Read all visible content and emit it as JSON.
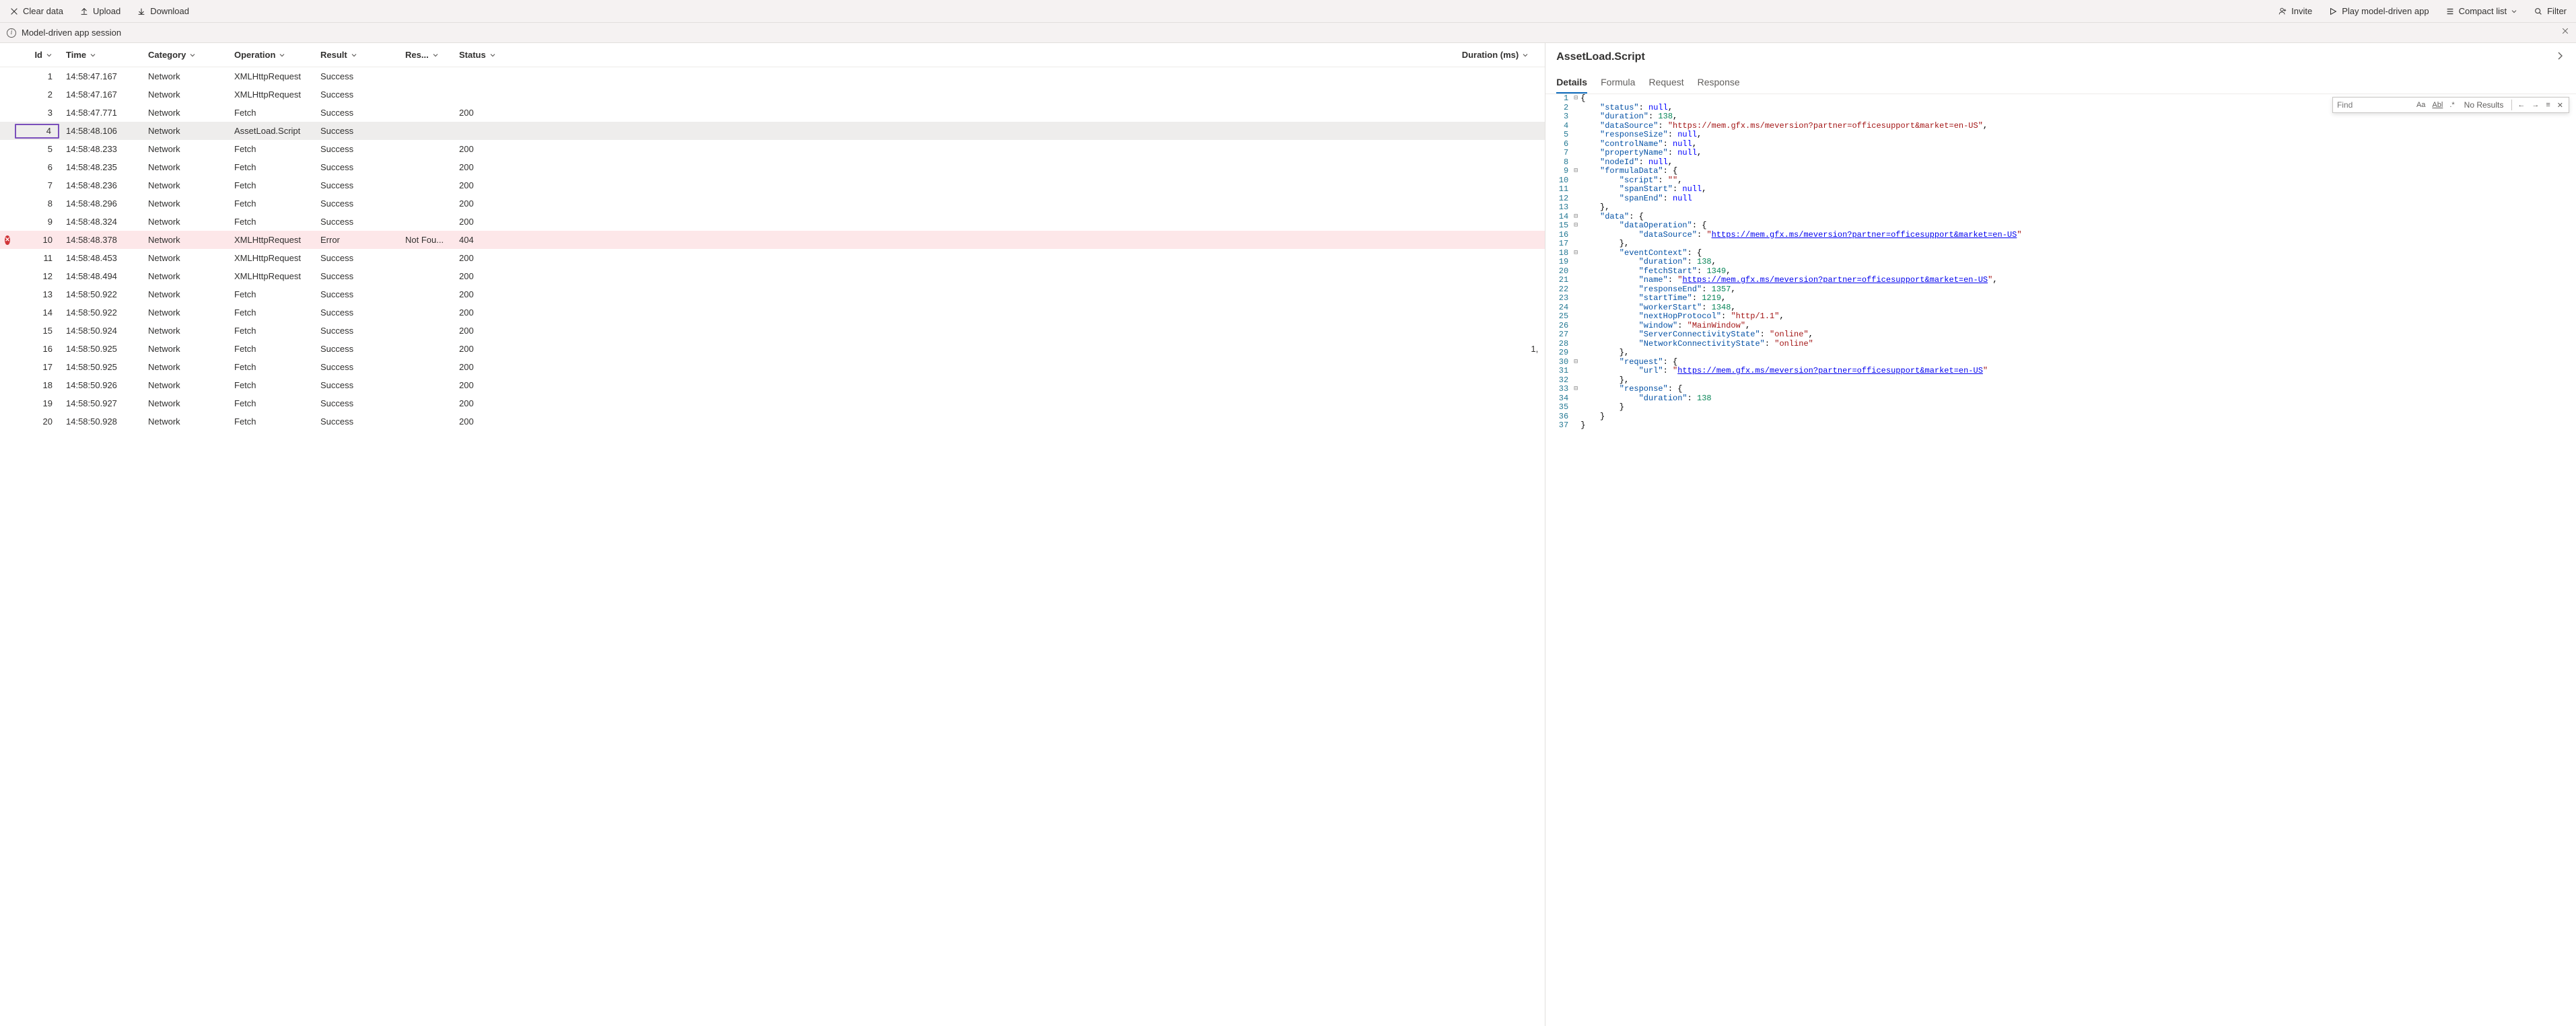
{
  "toolbar": {
    "clear": "Clear data",
    "upload": "Upload",
    "download": "Download",
    "invite": "Invite",
    "play": "Play model-driven app",
    "compact": "Compact list",
    "filter": "Filter"
  },
  "session": {
    "title": "Model-driven app session"
  },
  "table": {
    "columns": {
      "id": "Id",
      "time": "Time",
      "category": "Category",
      "operation": "Operation",
      "result": "Result",
      "result2": "Res...",
      "status": "Status",
      "duration": "Duration (ms)"
    },
    "rows": [
      {
        "id": 1,
        "time": "14:58:47.167",
        "category": "Network",
        "operation": "XMLHttpRequest",
        "result": "Success",
        "result2": "",
        "status": "",
        "duration": "",
        "flag": ""
      },
      {
        "id": 2,
        "time": "14:58:47.167",
        "category": "Network",
        "operation": "XMLHttpRequest",
        "result": "Success",
        "result2": "",
        "status": "",
        "duration": "",
        "flag": ""
      },
      {
        "id": 3,
        "time": "14:58:47.771",
        "category": "Network",
        "operation": "Fetch",
        "result": "Success",
        "result2": "",
        "status": "200",
        "duration": "",
        "flag": ""
      },
      {
        "id": 4,
        "time": "14:58:48.106",
        "category": "Network",
        "operation": "AssetLoad.Script",
        "result": "Success",
        "result2": "",
        "status": "",
        "duration": "",
        "flag": "selected"
      },
      {
        "id": 5,
        "time": "14:58:48.233",
        "category": "Network",
        "operation": "Fetch",
        "result": "Success",
        "result2": "",
        "status": "200",
        "duration": "",
        "flag": ""
      },
      {
        "id": 6,
        "time": "14:58:48.235",
        "category": "Network",
        "operation": "Fetch",
        "result": "Success",
        "result2": "",
        "status": "200",
        "duration": "",
        "flag": ""
      },
      {
        "id": 7,
        "time": "14:58:48.236",
        "category": "Network",
        "operation": "Fetch",
        "result": "Success",
        "result2": "",
        "status": "200",
        "duration": "",
        "flag": ""
      },
      {
        "id": 8,
        "time": "14:58:48.296",
        "category": "Network",
        "operation": "Fetch",
        "result": "Success",
        "result2": "",
        "status": "200",
        "duration": "",
        "flag": ""
      },
      {
        "id": 9,
        "time": "14:58:48.324",
        "category": "Network",
        "operation": "Fetch",
        "result": "Success",
        "result2": "",
        "status": "200",
        "duration": "",
        "flag": ""
      },
      {
        "id": 10,
        "time": "14:58:48.378",
        "category": "Network",
        "operation": "XMLHttpRequest",
        "result": "Error",
        "result2": "Not Fou...",
        "status": "404",
        "duration": "",
        "flag": "error"
      },
      {
        "id": 11,
        "time": "14:58:48.453",
        "category": "Network",
        "operation": "XMLHttpRequest",
        "result": "Success",
        "result2": "",
        "status": "200",
        "duration": "",
        "flag": ""
      },
      {
        "id": 12,
        "time": "14:58:48.494",
        "category": "Network",
        "operation": "XMLHttpRequest",
        "result": "Success",
        "result2": "",
        "status": "200",
        "duration": "",
        "flag": ""
      },
      {
        "id": 13,
        "time": "14:58:50.922",
        "category": "Network",
        "operation": "Fetch",
        "result": "Success",
        "result2": "",
        "status": "200",
        "duration": "",
        "flag": ""
      },
      {
        "id": 14,
        "time": "14:58:50.922",
        "category": "Network",
        "operation": "Fetch",
        "result": "Success",
        "result2": "",
        "status": "200",
        "duration": "",
        "flag": ""
      },
      {
        "id": 15,
        "time": "14:58:50.924",
        "category": "Network",
        "operation": "Fetch",
        "result": "Success",
        "result2": "",
        "status": "200",
        "duration": "",
        "flag": ""
      },
      {
        "id": 16,
        "time": "14:58:50.925",
        "category": "Network",
        "operation": "Fetch",
        "result": "Success",
        "result2": "",
        "status": "200",
        "duration": "1,",
        "flag": ""
      },
      {
        "id": 17,
        "time": "14:58:50.925",
        "category": "Network",
        "operation": "Fetch",
        "result": "Success",
        "result2": "",
        "status": "200",
        "duration": "",
        "flag": ""
      },
      {
        "id": 18,
        "time": "14:58:50.926",
        "category": "Network",
        "operation": "Fetch",
        "result": "Success",
        "result2": "",
        "status": "200",
        "duration": "",
        "flag": ""
      },
      {
        "id": 19,
        "time": "14:58:50.927",
        "category": "Network",
        "operation": "Fetch",
        "result": "Success",
        "result2": "",
        "status": "200",
        "duration": "",
        "flag": ""
      },
      {
        "id": 20,
        "time": "14:58:50.928",
        "category": "Network",
        "operation": "Fetch",
        "result": "Success",
        "result2": "",
        "status": "200",
        "duration": "",
        "flag": ""
      }
    ]
  },
  "details": {
    "title": "AssetLoad.Script",
    "tabs": [
      "Details",
      "Formula",
      "Request",
      "Response"
    ],
    "activeTab": 0,
    "find": {
      "placeholder": "Find",
      "result": "No Results"
    },
    "code": {
      "url": "https://mem.gfx.ms/meversion?partner=officesupport&market=en-US",
      "lines": [
        {
          "n": 1,
          "fold": "-",
          "t": [
            [
              "p",
              "{"
            ]
          ]
        },
        {
          "n": 2,
          "t": [
            [
              "p",
              "    "
            ],
            [
              "k",
              "\"status\""
            ],
            [
              "p",
              ": "
            ],
            [
              "b",
              "null"
            ],
            [
              "p",
              ","
            ]
          ]
        },
        {
          "n": 3,
          "t": [
            [
              "p",
              "    "
            ],
            [
              "k",
              "\"duration\""
            ],
            [
              "p",
              ": "
            ],
            [
              "n",
              "138"
            ],
            [
              "p",
              ","
            ]
          ]
        },
        {
          "n": 4,
          "t": [
            [
              "p",
              "    "
            ],
            [
              "k",
              "\"dataSource\""
            ],
            [
              "p",
              ": "
            ],
            [
              "s",
              "\"https://mem.gfx.ms/meversion?partner=officesupport&market=en-US\""
            ],
            [
              "p",
              ","
            ]
          ]
        },
        {
          "n": 5,
          "t": [
            [
              "p",
              "    "
            ],
            [
              "k",
              "\"responseSize\""
            ],
            [
              "p",
              ": "
            ],
            [
              "b",
              "null"
            ],
            [
              "p",
              ","
            ]
          ]
        },
        {
          "n": 6,
          "t": [
            [
              "p",
              "    "
            ],
            [
              "k",
              "\"controlName\""
            ],
            [
              "p",
              ": "
            ],
            [
              "b",
              "null"
            ],
            [
              "p",
              ","
            ]
          ]
        },
        {
          "n": 7,
          "t": [
            [
              "p",
              "    "
            ],
            [
              "k",
              "\"propertyName\""
            ],
            [
              "p",
              ": "
            ],
            [
              "b",
              "null"
            ],
            [
              "p",
              ","
            ]
          ]
        },
        {
          "n": 8,
          "t": [
            [
              "p",
              "    "
            ],
            [
              "k",
              "\"nodeId\""
            ],
            [
              "p",
              ": "
            ],
            [
              "b",
              "null"
            ],
            [
              "p",
              ","
            ]
          ]
        },
        {
          "n": 9,
          "fold": "-",
          "t": [
            [
              "p",
              "    "
            ],
            [
              "k",
              "\"formulaData\""
            ],
            [
              "p",
              ": {"
            ]
          ]
        },
        {
          "n": 10,
          "t": [
            [
              "p",
              "        "
            ],
            [
              "k",
              "\"script\""
            ],
            [
              "p",
              ": "
            ],
            [
              "s",
              "\"\""
            ],
            [
              "p",
              ","
            ]
          ]
        },
        {
          "n": 11,
          "t": [
            [
              "p",
              "        "
            ],
            [
              "k",
              "\"spanStart\""
            ],
            [
              "p",
              ": "
            ],
            [
              "b",
              "null"
            ],
            [
              "p",
              ","
            ]
          ]
        },
        {
          "n": 12,
          "t": [
            [
              "p",
              "        "
            ],
            [
              "k",
              "\"spanEnd\""
            ],
            [
              "p",
              ": "
            ],
            [
              "b",
              "null"
            ]
          ]
        },
        {
          "n": 13,
          "t": [
            [
              "p",
              "    },"
            ]
          ]
        },
        {
          "n": 14,
          "fold": "-",
          "t": [
            [
              "p",
              "    "
            ],
            [
              "k",
              "\"data\""
            ],
            [
              "p",
              ": {"
            ]
          ]
        },
        {
          "n": 15,
          "fold": "-",
          "t": [
            [
              "p",
              "        "
            ],
            [
              "k",
              "\"dataOperation\""
            ],
            [
              "p",
              ": {"
            ]
          ]
        },
        {
          "n": 16,
          "t": [
            [
              "p",
              "            "
            ],
            [
              "k",
              "\"dataSource\""
            ],
            [
              "p",
              ": "
            ],
            [
              "s",
              "\""
            ],
            [
              "u",
              "https://mem.gfx.ms/meversion?partner=officesupport&market=en-US"
            ],
            [
              "s",
              "\""
            ]
          ]
        },
        {
          "n": 17,
          "t": [
            [
              "p",
              "        },"
            ]
          ]
        },
        {
          "n": 18,
          "fold": "-",
          "t": [
            [
              "p",
              "        "
            ],
            [
              "k",
              "\"eventContext\""
            ],
            [
              "p",
              ": {"
            ]
          ]
        },
        {
          "n": 19,
          "t": [
            [
              "p",
              "            "
            ],
            [
              "k",
              "\"duration\""
            ],
            [
              "p",
              ": "
            ],
            [
              "n",
              "138"
            ],
            [
              "p",
              ","
            ]
          ]
        },
        {
          "n": 20,
          "t": [
            [
              "p",
              "            "
            ],
            [
              "k",
              "\"fetchStart\""
            ],
            [
              "p",
              ": "
            ],
            [
              "n",
              "1349"
            ],
            [
              "p",
              ","
            ]
          ]
        },
        {
          "n": 21,
          "t": [
            [
              "p",
              "            "
            ],
            [
              "k",
              "\"name\""
            ],
            [
              "p",
              ": "
            ],
            [
              "s",
              "\""
            ],
            [
              "u",
              "https://mem.gfx.ms/meversion?partner=officesupport&market=en-US"
            ],
            [
              "s",
              "\""
            ],
            [
              "p",
              ","
            ]
          ]
        },
        {
          "n": 22,
          "t": [
            [
              "p",
              "            "
            ],
            [
              "k",
              "\"responseEnd\""
            ],
            [
              "p",
              ": "
            ],
            [
              "n",
              "1357"
            ],
            [
              "p",
              ","
            ]
          ]
        },
        {
          "n": 23,
          "t": [
            [
              "p",
              "            "
            ],
            [
              "k",
              "\"startTime\""
            ],
            [
              "p",
              ": "
            ],
            [
              "n",
              "1219"
            ],
            [
              "p",
              ","
            ]
          ]
        },
        {
          "n": 24,
          "t": [
            [
              "p",
              "            "
            ],
            [
              "k",
              "\"workerStart\""
            ],
            [
              "p",
              ": "
            ],
            [
              "n",
              "1348"
            ],
            [
              "p",
              ","
            ]
          ]
        },
        {
          "n": 25,
          "t": [
            [
              "p",
              "            "
            ],
            [
              "k",
              "\"nextHopProtocol\""
            ],
            [
              "p",
              ": "
            ],
            [
              "s",
              "\"http/1.1\""
            ],
            [
              "p",
              ","
            ]
          ]
        },
        {
          "n": 26,
          "t": [
            [
              "p",
              "            "
            ],
            [
              "k",
              "\"window\""
            ],
            [
              "p",
              ": "
            ],
            [
              "s",
              "\"MainWindow\""
            ],
            [
              "p",
              ","
            ]
          ]
        },
        {
          "n": 27,
          "t": [
            [
              "p",
              "            "
            ],
            [
              "k",
              "\"ServerConnectivityState\""
            ],
            [
              "p",
              ": "
            ],
            [
              "s",
              "\"online\""
            ],
            [
              "p",
              ","
            ]
          ]
        },
        {
          "n": 28,
          "t": [
            [
              "p",
              "            "
            ],
            [
              "k",
              "\"NetworkConnectivityState\""
            ],
            [
              "p",
              ": "
            ],
            [
              "s",
              "\"online\""
            ]
          ]
        },
        {
          "n": 29,
          "t": [
            [
              "p",
              "        },"
            ]
          ]
        },
        {
          "n": 30,
          "fold": "-",
          "t": [
            [
              "p",
              "        "
            ],
            [
              "k",
              "\"request\""
            ],
            [
              "p",
              ": {"
            ]
          ]
        },
        {
          "n": 31,
          "t": [
            [
              "p",
              "            "
            ],
            [
              "k",
              "\"url\""
            ],
            [
              "p",
              ": "
            ],
            [
              "s",
              "\""
            ],
            [
              "u",
              "https://mem.gfx.ms/meversion?partner=officesupport&market=en-US"
            ],
            [
              "s",
              "\""
            ]
          ]
        },
        {
          "n": 32,
          "t": [
            [
              "p",
              "        },"
            ]
          ]
        },
        {
          "n": 33,
          "fold": "-",
          "t": [
            [
              "p",
              "        "
            ],
            [
              "k",
              "\"response\""
            ],
            [
              "p",
              ": {"
            ]
          ]
        },
        {
          "n": 34,
          "t": [
            [
              "p",
              "            "
            ],
            [
              "k",
              "\"duration\""
            ],
            [
              "p",
              ": "
            ],
            [
              "n",
              "138"
            ]
          ]
        },
        {
          "n": 35,
          "t": [
            [
              "p",
              "        }"
            ]
          ]
        },
        {
          "n": 36,
          "t": [
            [
              "p",
              "    }"
            ]
          ]
        },
        {
          "n": 37,
          "t": [
            [
              "p",
              "}"
            ]
          ]
        }
      ]
    }
  }
}
